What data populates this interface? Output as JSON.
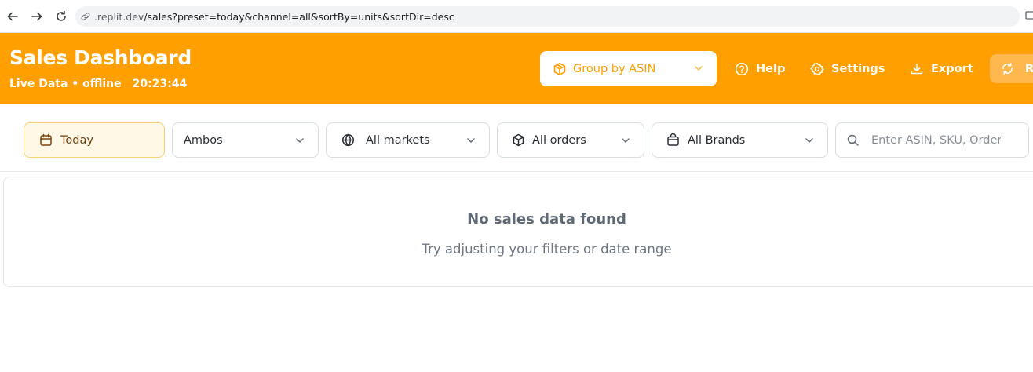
{
  "browser": {
    "url_host": ".replit.dev",
    "url_path": "/sales?preset=today&channel=all&sortBy=units&sortDir=desc"
  },
  "header": {
    "title": "Sales Dashboard",
    "status": "Live Data • offline",
    "time": "20:23:44",
    "group_by_label": "Group by ASIN",
    "help_label": "Help",
    "settings_label": "Settings",
    "export_label": "Export",
    "refresh_label": "R"
  },
  "filters": {
    "date_label": "Today",
    "account_label": "Ambos",
    "markets_label": "All markets",
    "orders_label": "All orders",
    "brands_label": "All Brands",
    "search_placeholder": "Enter ASIN, SKU, Order"
  },
  "empty_state": {
    "title": "No sales data found",
    "subtitle": "Try adjusting your filters or date range"
  },
  "colors": {
    "brand_orange": "#ff9f00",
    "date_filter_bg": "#fff8e6"
  }
}
